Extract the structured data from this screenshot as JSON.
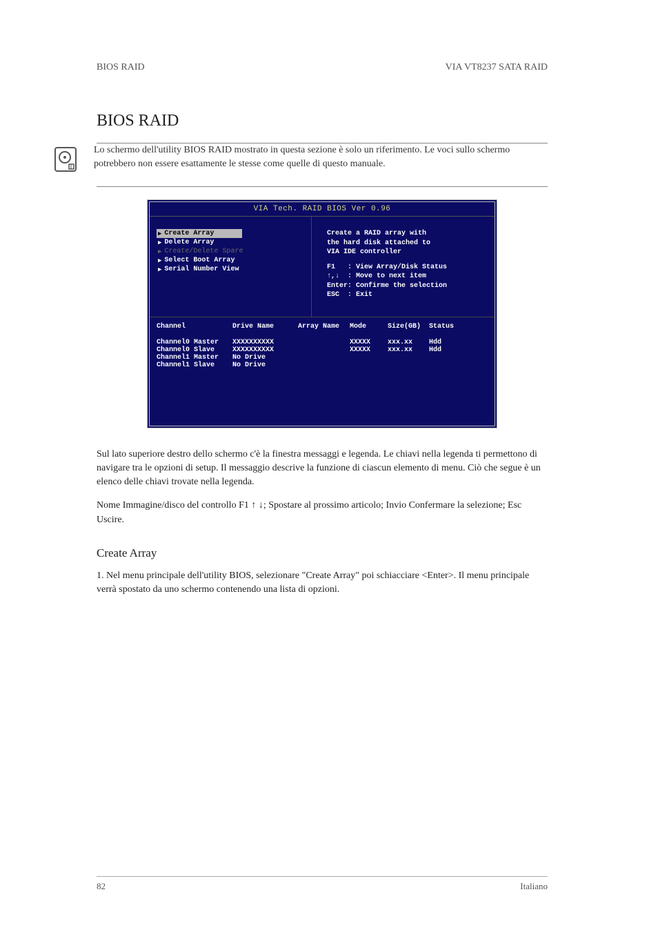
{
  "header": {
    "left": "BIOS RAID",
    "right": "VIA VT8237 SATA RAID"
  },
  "section_title": "BIOS RAID",
  "note": "Lo schermo dell'utility BIOS RAID mostrato in questa sezione è solo un riferimento. Le voci sullo schermo potrebbero non essere esattamente le stesse come quelle di questo manuale.",
  "bios": {
    "title": "VIA Tech. RAID BIOS Ver 0.96",
    "menu": {
      "items": [
        {
          "label": "Create Array",
          "selected": true,
          "disabled": false
        },
        {
          "label": "Delete Array",
          "selected": false,
          "disabled": false
        },
        {
          "label": "Create/Delete Spare",
          "selected": false,
          "disabled": true
        },
        {
          "label": "Select Boot Array",
          "selected": false,
          "disabled": false
        },
        {
          "label": "Serial Number View",
          "selected": false,
          "disabled": false
        }
      ]
    },
    "help": {
      "line1": "Create a RAID array with",
      "line2": "the hard disk attached to",
      "line3": "VIA IDE controller",
      "f1": "F1   : View Array/Disk Status",
      "arrows": "↑,↓  : Move to next item",
      "enter": "Enter: Confirme the selection",
      "esc": "ESC  : Exit"
    },
    "table": {
      "headers": {
        "c1": "Channel",
        "c2": "Drive Name",
        "c3": "Array Name",
        "c4": "Mode",
        "c5": "Size(GB)",
        "c6": "Status"
      },
      "rows": [
        {
          "c1": "Channel0 Master",
          "c2": "XXXXXXXXXX",
          "c3": "",
          "c4": "XXXXX",
          "c5": "xxx.xx",
          "c6": "Hdd"
        },
        {
          "c1": "Channel0 Slave",
          "c2": "XXXXXXXXXX",
          "c3": "",
          "c4": "XXXXX",
          "c5": "xxx.xx",
          "c6": "Hdd"
        },
        {
          "c1": "Channel1 Master",
          "c2": "No Drive",
          "c3": "",
          "c4": "",
          "c5": "",
          "c6": ""
        },
        {
          "c1": "Channel1 Slave",
          "c2": "No Drive",
          "c3": "",
          "c4": "",
          "c5": "",
          "c6": ""
        }
      ]
    }
  },
  "paragraphs": {
    "p1": "Sul lato superiore destro dello schermo c'è la finestra messaggi e legenda. Le chiavi nella legenda ti permettono di navigare tra le opzioni di setup. Il messaggio descrive la funzione di ciascun elemento di menu. Ciò che segue è un elenco delle chiavi trovate nella legenda.",
    "p2": "Nome Immagine/disco del controllo F1 ↑ ↓; Spostare al prossimo articolo; Invio Confermare la selezione; Esc Uscire.",
    "subhead": "Create Array",
    "p3": "1. Nel menu principale dell'utility BIOS, selezionare \"Create Array\" poi schiacciare <Enter>. Il menu principale verrà spostato da uno schermo contenendo una lista di opzioni."
  },
  "footer": {
    "left": "82",
    "right": "Italiano"
  }
}
